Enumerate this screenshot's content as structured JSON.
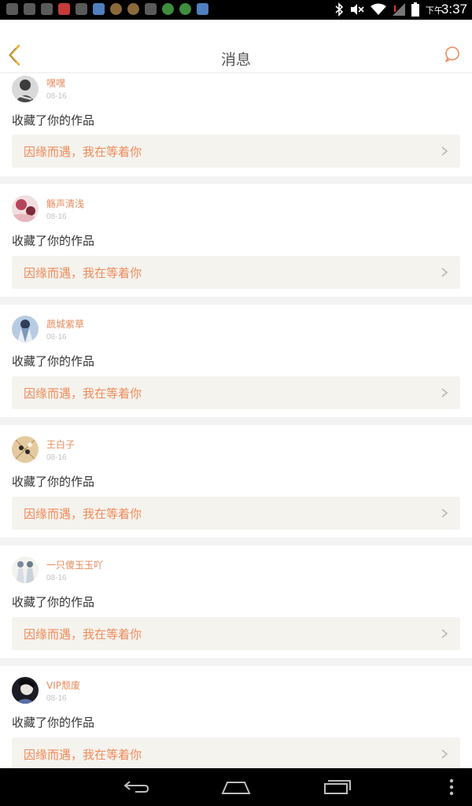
{
  "status_bar": {
    "left_icons": [
      "keyboard-icon",
      "lock-icon",
      "image-icon",
      "app-icon",
      "tiktok-icon",
      "app-icon",
      "app-icon",
      "app-icon",
      "app-icon",
      "app-icon",
      "app-icon",
      "shield-icon"
    ],
    "ampm": "下午",
    "time": "3:37"
  },
  "header": {
    "title": "消息",
    "back_icon": "chevron-left-icon",
    "chat_icon": "chat-bubble-icon",
    "accent_color": "#e8a74c"
  },
  "notifications": [
    {
      "user": "嘿嘿",
      "date": "08-16",
      "action": "收藏了你的作品",
      "work_title": "因缘而遇，我在等着你"
    },
    {
      "user": "觞声清浅",
      "date": "08-16",
      "action": "收藏了你的作品",
      "work_title": "因缘而遇，我在等着你"
    },
    {
      "user": "蔬城紫草",
      "date": "08-16",
      "action": "收藏了你的作品",
      "work_title": "因缘而遇，我在等着你"
    },
    {
      "user": "王白子",
      "date": "08-16",
      "action": "收藏了你的作品",
      "work_title": "因缘而遇，我在等着你"
    },
    {
      "user": "一只傻玉玉吖",
      "date": "08-16",
      "action": "收藏了你的作品",
      "work_title": "因缘而遇，我在等着你"
    },
    {
      "user": "VIP颓废",
      "date": "08-16",
      "action": "收藏了你的作品",
      "work_title": "因缘而遇，我在等着你"
    }
  ],
  "colors": {
    "username": "#e68a5c",
    "work_title": "#ef8b5b",
    "work_background": "#f4f3ee",
    "separator": "#f3f3f3"
  },
  "nav_bar": {
    "buttons": [
      "back-icon",
      "home-icon",
      "recent-apps-icon",
      "menu-icon"
    ]
  }
}
